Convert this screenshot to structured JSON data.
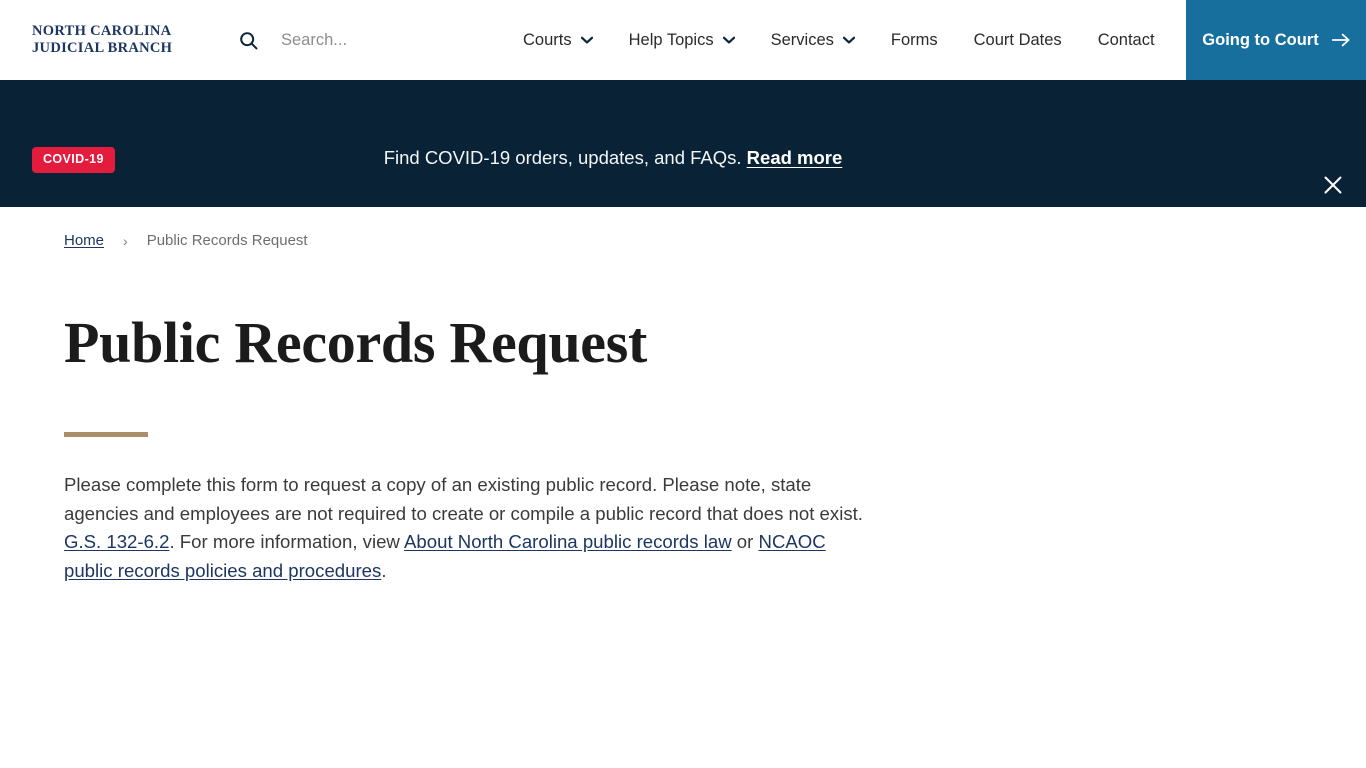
{
  "header": {
    "logo": {
      "line1": "NORTH CAROLINA",
      "line2": "JUDICIAL BRANCH",
      "icon": "nc-judicial-branch-logo"
    },
    "search": {
      "icon": "search-icon",
      "placeholder": "Search...",
      "value": ""
    },
    "nav_items": [
      {
        "label": "Courts",
        "has_dropdown": true,
        "icon": "chevron-down-icon"
      },
      {
        "label": "Help Topics",
        "has_dropdown": true,
        "icon": "chevron-down-icon"
      },
      {
        "label": "Services",
        "has_dropdown": true,
        "icon": "chevron-down-icon"
      },
      {
        "label": "Forms",
        "has_dropdown": false
      },
      {
        "label": "Court Dates",
        "has_dropdown": false
      },
      {
        "label": "Contact",
        "has_dropdown": false
      }
    ],
    "cta": {
      "label": "Going to Court",
      "icon": "arrow-right-icon",
      "background": "#176f9e"
    }
  },
  "banner": {
    "badge": "COVID-19",
    "badge_color": "#e31b3d",
    "background": "#0a2236",
    "text": "Find COVID-19 orders, updates, and FAQs.",
    "link_label": "Read more",
    "close_icon": "close-icon"
  },
  "breadcrumb": {
    "home_label": "Home",
    "separator": "›",
    "current_label": "Public Records Request"
  },
  "main": {
    "title": "Public Records Request",
    "accent_color": "#a98e69",
    "paragraph": {
      "part1": "Please complete this form to request a copy of an existing public record. Please note, state agencies and employees are not required to create or compile a public record that does not exist. ",
      "link1": "G.S. 132-6.2",
      "part2": ". For more information, view ",
      "link2": "About North Carolina public records law",
      "part3": " or ",
      "link3": "NCAOC public records policies and procedures",
      "part4": "."
    }
  }
}
